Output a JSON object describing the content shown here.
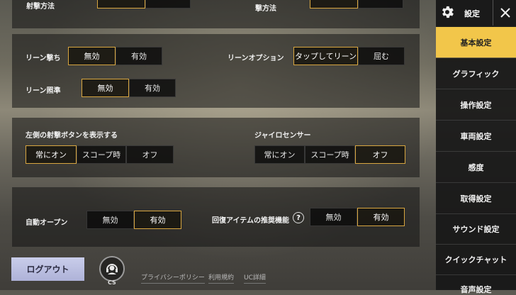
{
  "panel_top": {
    "left_label": "射撃方法",
    "right_label": "撃方法"
  },
  "lean": {
    "lean_fire_label": "リーン撃ち",
    "lean_fire_options": [
      "無効",
      "有効"
    ],
    "lean_option_label": "リーンオプション",
    "lean_option_options": [
      "タップしてリーン",
      "屈む"
    ],
    "lean_aim_label": "リーン照準",
    "lean_aim_options": [
      "無効",
      "有効"
    ]
  },
  "fire_display": {
    "left_fire_label": "左側の射撃ボタンを表示する",
    "left_fire_options": [
      "常にオン",
      "スコープ時",
      "オフ"
    ],
    "gyro_label": "ジャイロセンサー",
    "gyro_options": [
      "常にオン",
      "スコープ時",
      "オフ"
    ]
  },
  "auto": {
    "auto_open_label": "自動オープン",
    "auto_open_options": [
      "無効",
      "有効"
    ],
    "heal_label": "回復アイテムの推奨機能",
    "heal_options": [
      "無効",
      "有効"
    ]
  },
  "footer": {
    "logout": "ログアウト",
    "cs": "CS",
    "privacy": "プライバシーポリシー",
    "terms": "利用規約",
    "uc": "UC詳細"
  },
  "sidebar": {
    "title": "設定",
    "items": [
      "基本設定",
      "グラフィック",
      "操作設定",
      "車両設定",
      "感度",
      "取得設定",
      "サウンド設定",
      "クイックチャット",
      "音声設定"
    ]
  },
  "colors": {
    "accent": "#d8a640",
    "active_tab": "#f2c64a"
  }
}
